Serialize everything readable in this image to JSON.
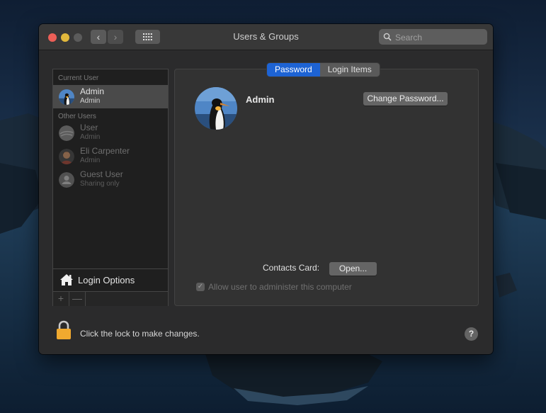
{
  "window": {
    "title": "Users & Groups",
    "search_placeholder": "Search"
  },
  "sidebar": {
    "current_user_header": "Current User",
    "other_users_header": "Other Users",
    "current_user": {
      "name": "Admin",
      "role": "Admin"
    },
    "other_users": [
      {
        "name": "User",
        "role": "Admin"
      },
      {
        "name": "Eli Carpenter",
        "role": "Admin"
      },
      {
        "name": "Guest User",
        "role": "Sharing only"
      }
    ],
    "login_options_label": "Login Options",
    "add_symbol": "+",
    "remove_symbol": "—"
  },
  "tabs": [
    {
      "label": "Password",
      "active": true
    },
    {
      "label": "Login Items",
      "active": false
    }
  ],
  "detail": {
    "user_name": "Admin",
    "change_password_label": "Change Password...",
    "contacts_card_label": "Contacts Card:",
    "open_label": "Open...",
    "allow_admin_label": "Allow user to administer this computer",
    "allow_admin_checked": true
  },
  "footer": {
    "lock_text": "Click the lock to make changes.",
    "help_label": "?"
  },
  "colors": {
    "accent": "#1d63d4",
    "window_bg": "#2b2b2c",
    "lock": "#f0a92f"
  }
}
